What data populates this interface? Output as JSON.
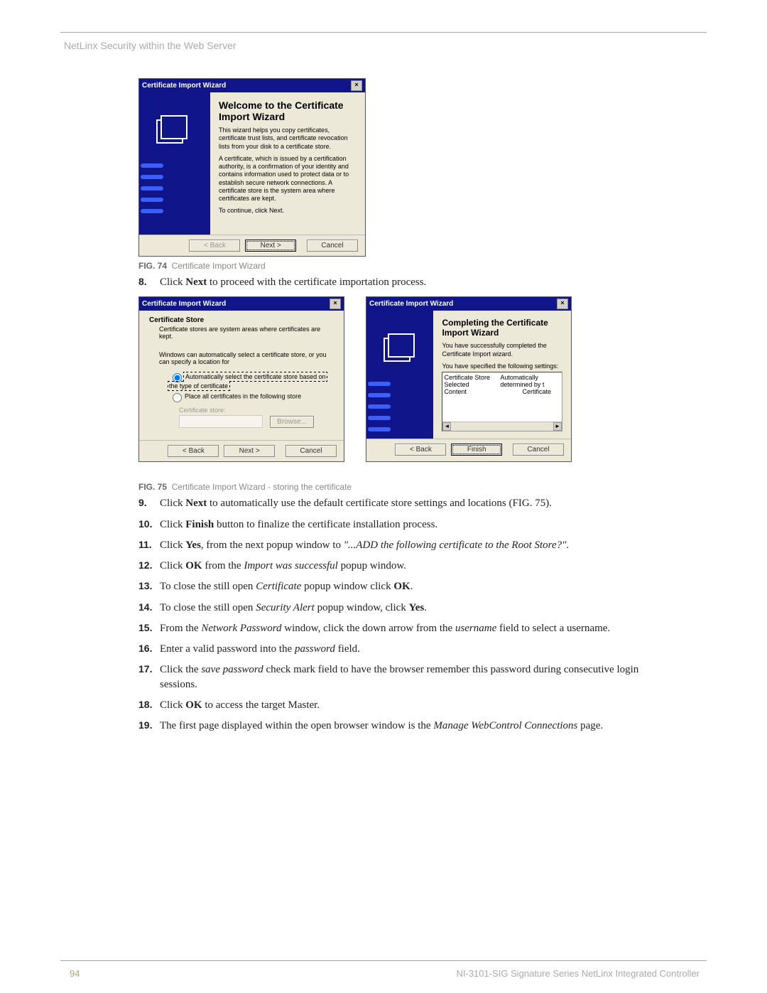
{
  "header": "NetLinx Security within the Web Server",
  "footer": {
    "page": "94",
    "right": "NI-3101-SIG Signature Series NetLinx Integrated Controller"
  },
  "wizard1": {
    "title": "Certificate Import Wizard",
    "heading": "Welcome to the Certificate Import Wizard",
    "p1": "This wizard helps you copy certificates, certificate trust lists, and certificate revocation lists from your disk to a certificate store.",
    "p2": "A certificate, which is issued by a certification authority, is a confirmation of your identity and contains information used to protect data or to establish secure network connections. A certificate store is the system area where certificates are kept.",
    "p3": "To continue, click Next.",
    "btn_back": "< Back",
    "btn_next": "Next >",
    "btn_cancel": "Cancel"
  },
  "caption74": {
    "label": "FIG. 74",
    "text": "Certificate Import Wizard"
  },
  "step8": {
    "num": "8.",
    "pre": "Click ",
    "bold": "Next",
    "post": " to proceed with the certificate importation process."
  },
  "wizard2": {
    "title": "Certificate Import Wizard",
    "heading": "Certificate Store",
    "sub": "Certificate stores are system areas where certificates are kept.",
    "line": "Windows can automatically select a certificate store, or you can specify a location for",
    "r1": "Automatically select the certificate store based on the type of certificate",
    "r2": "Place all certificates in the following store",
    "store_label": "Certificate store:",
    "browse": "Browse...",
    "btn_back": "< Back",
    "btn_next": "Next >",
    "btn_cancel": "Cancel"
  },
  "wizard3": {
    "title": "Certificate Import Wizard",
    "heading": "Completing the Certificate Import Wizard",
    "p1": "You have successfully completed the Certificate Import wizard.",
    "p2": "You have specified the following settings:",
    "row1a": "Certificate Store Selected",
    "row1b": "Automatically determined by t",
    "row2a": "Content",
    "row2b": "Certificate",
    "btn_back": "< Back",
    "btn_next": "Finish",
    "btn_cancel": "Cancel"
  },
  "caption75": {
    "label": "FIG. 75",
    "text": "Certificate Import Wizard - storing the certificate"
  },
  "steps": [
    {
      "num": "9.",
      "html": "Click <b>Next</b> to automatically use the default certificate store settings and locations (FIG. 75)."
    },
    {
      "num": "10.",
      "html": "Click <b>Finish</b> button to finalize the certificate installation process."
    },
    {
      "num": "11.",
      "html": "Click <b>Yes</b>, from the next popup window to <i>\"...ADD the following certificate to the Root Store?\"</i>."
    },
    {
      "num": "12.",
      "html": "Click <b>OK</b> from the <i>Import was successful</i> popup window."
    },
    {
      "num": "13.",
      "html": "To close the still open <i>Certificate</i> popup window click <b>OK</b>."
    },
    {
      "num": "14.",
      "html": "To close the still open <i>Security Alert</i> popup window, click <b>Yes</b>."
    },
    {
      "num": "15.",
      "html": "From the <i>Network Password</i> window, click the down arrow from the <i>username</i> field to select a username."
    },
    {
      "num": "16.",
      "html": "Enter a valid password into the <i>password</i> field."
    },
    {
      "num": "17.",
      "html": "Click the <i>save password</i> check mark field to have the browser remember this password during consecutive login sessions."
    },
    {
      "num": "18.",
      "html": "Click <b>OK</b> to access the target Master."
    },
    {
      "num": "19.",
      "html": "The first page displayed within the open browser window is the <i>Manage WebControl Connections</i> page."
    }
  ]
}
